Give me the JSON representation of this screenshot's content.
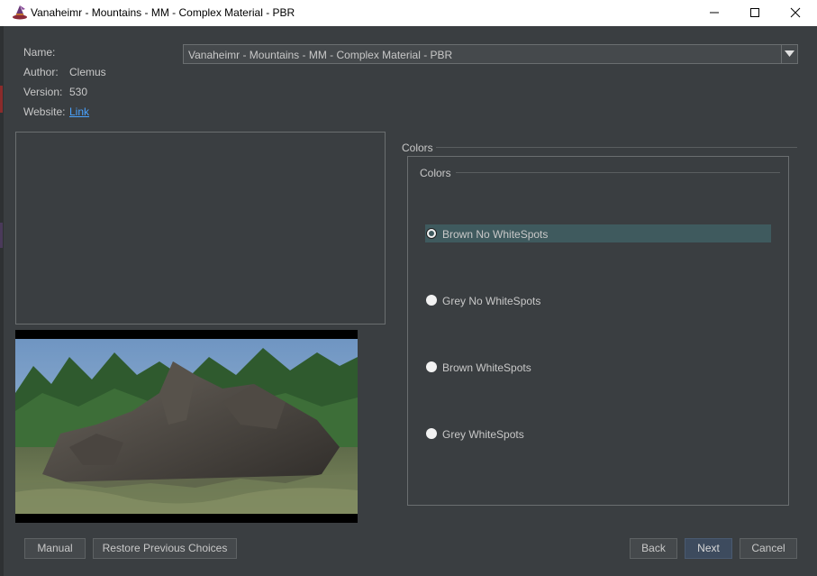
{
  "window": {
    "title": "Vanaheimr - Mountains - MM - Complex Material - PBR",
    "icon": "wizard-hat-icon"
  },
  "info": {
    "name_label": "Name:",
    "author_label": "Author:",
    "author_value": "Clemus",
    "version_label": "Version:",
    "version_value": "530",
    "website_label": "Website:",
    "website_link": "Link"
  },
  "name_select": {
    "value": "Vanaheimr - Mountains - MM - Complex Material - PBR"
  },
  "group": {
    "outer_label": "Colors",
    "inner_label": "Colors",
    "options": [
      {
        "label": "Brown No WhiteSpots",
        "selected": true
      },
      {
        "label": "Grey No WhiteSpots",
        "selected": false
      },
      {
        "label": "Brown WhiteSpots",
        "selected": false
      },
      {
        "label": "Grey WhiteSpots",
        "selected": false
      }
    ]
  },
  "buttons": {
    "manual": "Manual",
    "restore": "Restore Previous Choices",
    "back": "Back",
    "next": "Next",
    "cancel": "Cancel"
  },
  "colors": {
    "background": "#3a3e41",
    "selected_row": "#3f5a5e",
    "link": "#4aa3ff",
    "next_button": "#3d4b5e"
  }
}
